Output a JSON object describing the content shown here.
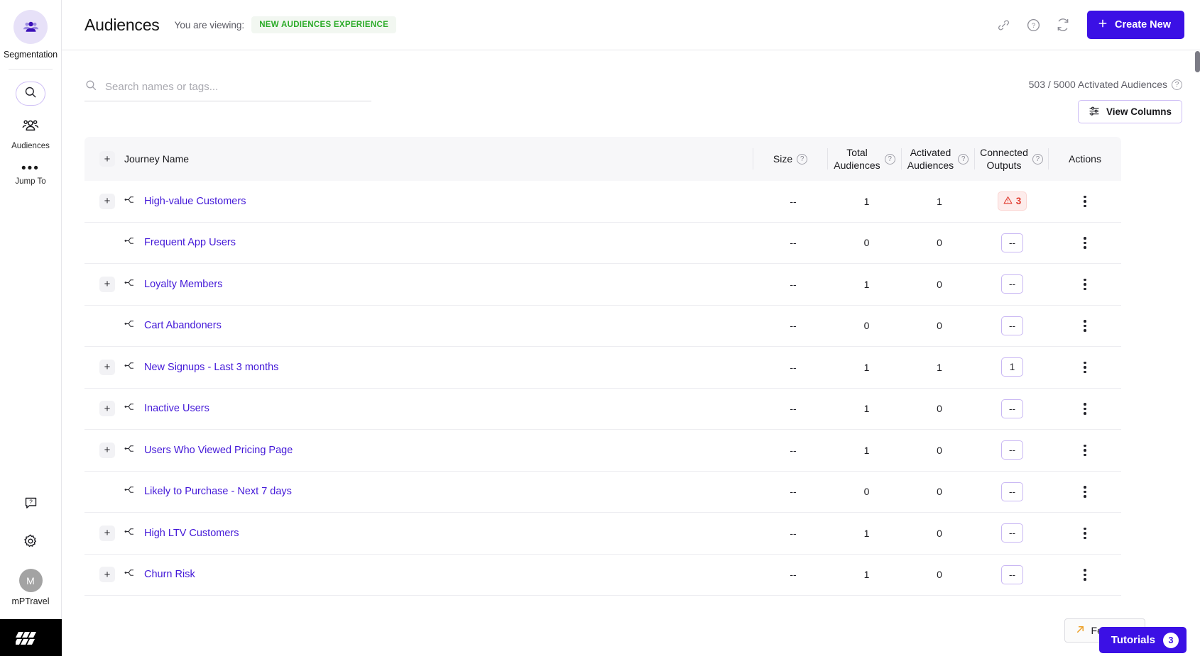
{
  "sidebar": {
    "segmentation_label": "Segmentation",
    "search_icon": "search-icon",
    "nav_items": [
      {
        "label": "Audiences",
        "icon": "audiences-people-icon"
      },
      {
        "label": "Jump To",
        "icon": "ellipsis-icon"
      }
    ],
    "help_icon": "help-chat-icon",
    "settings_icon": "gear-icon",
    "avatar_initial": "M",
    "account_name": "mPTravel",
    "brand_logo": "moengage-logo"
  },
  "header": {
    "title": "Audiences",
    "viewing_label": "You are viewing:",
    "experience_badge": "NEW AUDIENCES EXPERIENCE",
    "icons": [
      {
        "name": "link-icon"
      },
      {
        "name": "help-circle-icon"
      },
      {
        "name": "refresh-icon"
      }
    ],
    "create_button": "Create New",
    "create_icon": "plus-icon"
  },
  "search": {
    "placeholder": "Search names or tags...",
    "value": "",
    "icon": "search-icon"
  },
  "meta": {
    "activated_text": "503 / 5000 Activated Audiences",
    "activated_help_icon": "help-circle-icon",
    "view_columns_label": "View Columns",
    "view_columns_icon": "sliders-icon"
  },
  "table": {
    "columns": [
      {
        "key": "journey",
        "label": "Journey Name",
        "help": false
      },
      {
        "key": "size",
        "label": "Size",
        "help": true
      },
      {
        "key": "total",
        "label": "Total\nAudiences",
        "line1": "Total",
        "line2": "Audiences",
        "help": true
      },
      {
        "key": "activated",
        "label": "Activated\nAudiences",
        "line1": "Activated",
        "line2": "Audiences",
        "help": true
      },
      {
        "key": "connected",
        "label": "Connected\nOutputs",
        "line1": "Connected",
        "line2": "Outputs",
        "help": true
      },
      {
        "key": "actions",
        "label": "Actions",
        "help": false
      }
    ],
    "header_expand_icon": "plus-icon",
    "rows": [
      {
        "name": "High-value Customers",
        "expandable": true,
        "size": "--",
        "total": "1",
        "activated": "1",
        "connected": "3",
        "connected_state": "warn"
      },
      {
        "name": "Frequent App Users",
        "expandable": false,
        "size": "--",
        "total": "0",
        "activated": "0",
        "connected": "--",
        "connected_state": "empty"
      },
      {
        "name": "Loyalty Members",
        "expandable": true,
        "size": "--",
        "total": "1",
        "activated": "0",
        "connected": "--",
        "connected_state": "empty"
      },
      {
        "name": "Cart Abandoners",
        "expandable": false,
        "size": "--",
        "total": "0",
        "activated": "0",
        "connected": "--",
        "connected_state": "empty"
      },
      {
        "name": "New Signups - Last 3 months",
        "expandable": true,
        "size": "--",
        "total": "1",
        "activated": "1",
        "connected": "1",
        "connected_state": "count"
      },
      {
        "name": "Inactive Users",
        "expandable": true,
        "size": "--",
        "total": "1",
        "activated": "0",
        "connected": "--",
        "connected_state": "empty"
      },
      {
        "name": "Users Who Viewed Pricing Page",
        "expandable": true,
        "size": "--",
        "total": "1",
        "activated": "0",
        "connected": "--",
        "connected_state": "empty"
      },
      {
        "name": "Likely to Purchase - Next 7 days",
        "expandable": false,
        "size": "--",
        "total": "0",
        "activated": "0",
        "connected": "--",
        "connected_state": "empty"
      },
      {
        "name": "High LTV Customers",
        "expandable": true,
        "size": "--",
        "total": "1",
        "activated": "0",
        "connected": "--",
        "connected_state": "empty"
      },
      {
        "name": "Churn Risk",
        "expandable": true,
        "size": "--",
        "total": "1",
        "activated": "0",
        "connected": "--",
        "connected_state": "empty"
      }
    ],
    "row_icon": "journey-branch-icon",
    "actions_icon": "kebab-menu-icon"
  },
  "floating": {
    "feedback_label": "Feedback",
    "feedback_icon": "arrow-up-right-icon",
    "tutorials_label": "Tutorials",
    "tutorials_count": "3"
  },
  "colors": {
    "accent": "#3b10e5",
    "link": "#4318d8",
    "badge_green": "#2bab28",
    "warn_red": "#e0392d"
  }
}
